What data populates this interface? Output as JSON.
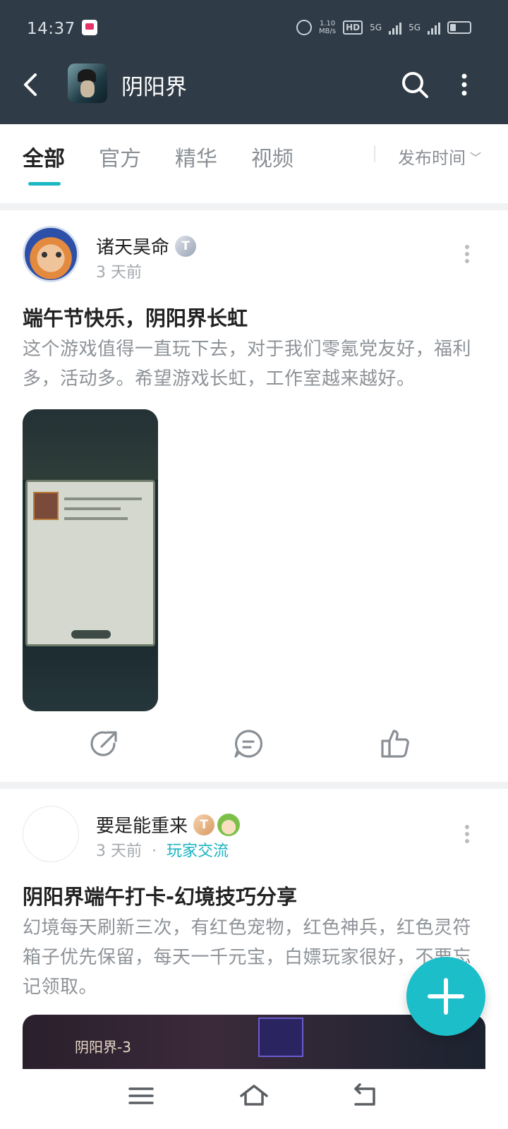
{
  "status": {
    "time": "14:37",
    "speed_top": "1.10",
    "speed_unit": "MB/s",
    "hd": "HD",
    "net1": "5G",
    "net2": "5G"
  },
  "app_bar": {
    "title": "阴阳界"
  },
  "tabs": {
    "items": [
      "全部",
      "官方",
      "精华",
      "视频"
    ],
    "active": "全部",
    "sort_label": "发布时间"
  },
  "posts": [
    {
      "author": "诸天昊命",
      "badge": "T",
      "time": "3 天前",
      "title": "端午节快乐，阴阳界长虹",
      "body": "这个游戏值得一直玩下去，对于我们零氪党友好，福利多，活动多。希望游戏长虹，工作室越来越好。"
    },
    {
      "author": "要是能重来",
      "badge": "T",
      "time": "3 天前",
      "tag": "玩家交流",
      "title": "阴阳界端午打卡-幻境技巧分享",
      "body": "幻境每天刷新三次，有红色宠物，红色神兵，红色灵符箱子优先保留，每天一千元宝，白嫖玩家很好，不要忘记领取。",
      "cover_label": "阴阳界-3"
    }
  ],
  "colors": {
    "header_bg": "#2f3b46",
    "accent": "#1ab7c4",
    "fab": "#1bbec9"
  },
  "icons": {
    "back": "chevron-left-icon",
    "search": "search-icon",
    "more": "more-vertical-icon",
    "share": "share-icon",
    "comment": "comment-icon",
    "like": "thumbs-up-icon",
    "fab": "plus-icon",
    "nav_menu": "menu-icon",
    "nav_home": "home-icon",
    "nav_back": "back-icon"
  }
}
